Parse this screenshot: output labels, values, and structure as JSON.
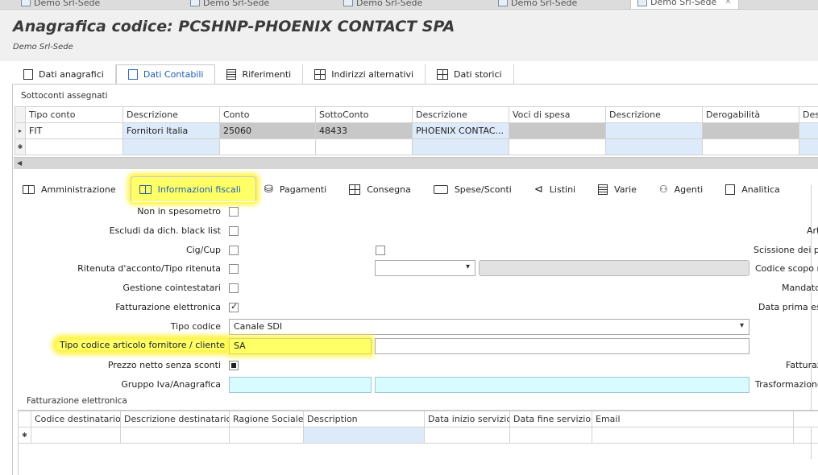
{
  "doc_tabs": [
    {
      "label": "Demo Srl-Sede"
    },
    {
      "label": "Demo Srl-Sede"
    },
    {
      "label": "Demo Srl-Sede"
    },
    {
      "label": "Demo Srl-Sede"
    },
    {
      "label": "Demo Srl-Sede"
    }
  ],
  "header": {
    "title": "Anagrafica codice: PCSHNP-PHOENIX CONTACT SPA",
    "subtitle": "Demo Srl-Sede"
  },
  "main_tabs": [
    {
      "label": "Dati anagrafici",
      "icon": "page-icon"
    },
    {
      "label": "Dati Contabili",
      "icon": "page-icon",
      "active": true
    },
    {
      "label": "Riferimenti",
      "icon": "document-icon"
    },
    {
      "label": "Indirizzi alternativi",
      "icon": "grid-icon"
    },
    {
      "label": "Dati storici",
      "icon": "grid-icon"
    }
  ],
  "sottoconti": {
    "section_label": "Sottoconti assegnati",
    "columns": [
      "Tipo conto",
      "Descrizione",
      "Conto",
      "SottoConto",
      "Descrizione",
      "Voci di spesa",
      "Descrizione",
      "Derogabilità",
      "Des"
    ],
    "rows": [
      [
        "FIT",
        "Fornitori Italia",
        "25060",
        "48433",
        "PHOENIX CONTAC...",
        "",
        "",
        "",
        ""
      ]
    ],
    "row_markers": [
      "▸",
      "✱"
    ]
  },
  "sub_tabs": [
    {
      "label": "Amministrazione",
      "icon": "book-icon"
    },
    {
      "label": "Informazioni fiscali",
      "icon": "book-icon",
      "active": true
    },
    {
      "label": "Pagamenti",
      "icon": "payment-icon"
    },
    {
      "label": "Consegna",
      "icon": "calendar-icon"
    },
    {
      "label": "Spese/Sconti",
      "icon": "card-icon"
    },
    {
      "label": "Listini",
      "icon": "tag-icon"
    },
    {
      "label": "Varie",
      "icon": "list-icon"
    },
    {
      "label": "Agenti",
      "icon": "people-icon"
    },
    {
      "label": "Analitica",
      "icon": "chart-icon"
    }
  ],
  "fiscal_form": {
    "non_spesometro": {
      "label": "Non in spesometro",
      "checked": false
    },
    "escludi_black_list": {
      "label": "Escludi da dich. black list",
      "checked": false
    },
    "cig_cup": {
      "label": "Cig/Cup",
      "checked": false
    },
    "ritenuta": {
      "label": "Ritenuta d'acconto/Tipo ritenuta",
      "checked": false
    },
    "gestione_cointestatari": {
      "label": "Gestione cointestatari",
      "checked": false
    },
    "fatturazione_elettronica": {
      "label": "Fatturazione elettronica",
      "checked": true
    },
    "tipo_codice": {
      "label": "Tipo codice",
      "value": "Canale SDI"
    },
    "tipo_codice_articolo": {
      "label": "Tipo codice articolo fornitore / cliente",
      "value": "SA"
    },
    "prezzo_netto": {
      "label": "Prezzo netto senza sconti",
      "checked": true
    },
    "gruppo_iva": {
      "label": "Gruppo Iva/Anagrafica",
      "value": ""
    },
    "right_labels": [
      "Art",
      "Scissione dei p",
      "Codice scopo r",
      "Mandato",
      "Data prima es",
      "Fatturaz",
      "Trasformazione"
    ]
  },
  "fe_grid": {
    "section_label": "Fatturazione elettronica",
    "columns": [
      "Codice destinatario",
      "Descrizione destinatario",
      "Ragione Sociale",
      "Description",
      "Data inizio servizio",
      "Data fine servizio",
      "Email"
    ],
    "new_row_marker": "✱"
  },
  "colors": {
    "highlight": "#ffff66",
    "active_tab_text": "#1f5fb0",
    "cyan_field": "#d8fbff",
    "gray_cell": "#c8c8c8"
  }
}
